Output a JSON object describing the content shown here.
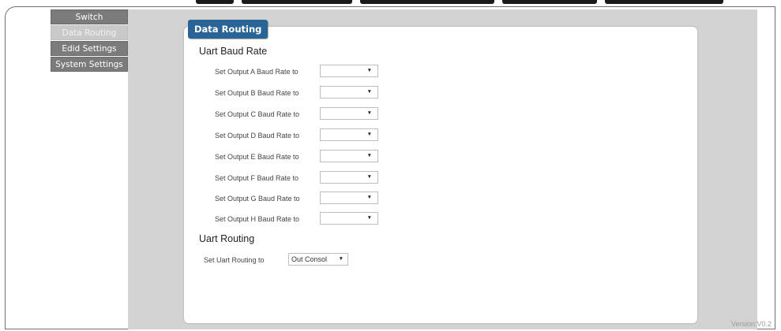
{
  "sidebar": {
    "items": [
      {
        "label": "Switch"
      },
      {
        "label": "Data Routing"
      },
      {
        "label": "Edid Settings"
      },
      {
        "label": "System Settings"
      }
    ]
  },
  "panel": {
    "tab_label": "Data Routing",
    "baud_section_title": "Uart Baud Rate",
    "baud_rows": [
      {
        "label": "Set Output A Baud Rate to",
        "value": ""
      },
      {
        "label": "Set Output B Baud Rate to",
        "value": ""
      },
      {
        "label": "Set Output C Baud Rate to",
        "value": ""
      },
      {
        "label": "Set Output D Baud Rate to",
        "value": ""
      },
      {
        "label": "Set Output E Baud Rate to",
        "value": ""
      },
      {
        "label": "Set Output F Baud Rate to",
        "value": ""
      },
      {
        "label": "Set Output G Baud Rate to",
        "value": ""
      },
      {
        "label": "Set Output H Baud Rate to",
        "value": ""
      }
    ],
    "routing_section_title": "Uart Routing",
    "routing_label": "Set Uart Routing to",
    "routing_value": "Out Consol"
  },
  "version": "Version:V0.2",
  "colors": {
    "tab_bg": "#2a6496",
    "sidebar_btn": "#7b7b7b",
    "sidebar_active": "#c9c9c9",
    "main_bg": "#d3d3d3"
  },
  "icons": {
    "dropdown": "triangle-down-icon"
  }
}
